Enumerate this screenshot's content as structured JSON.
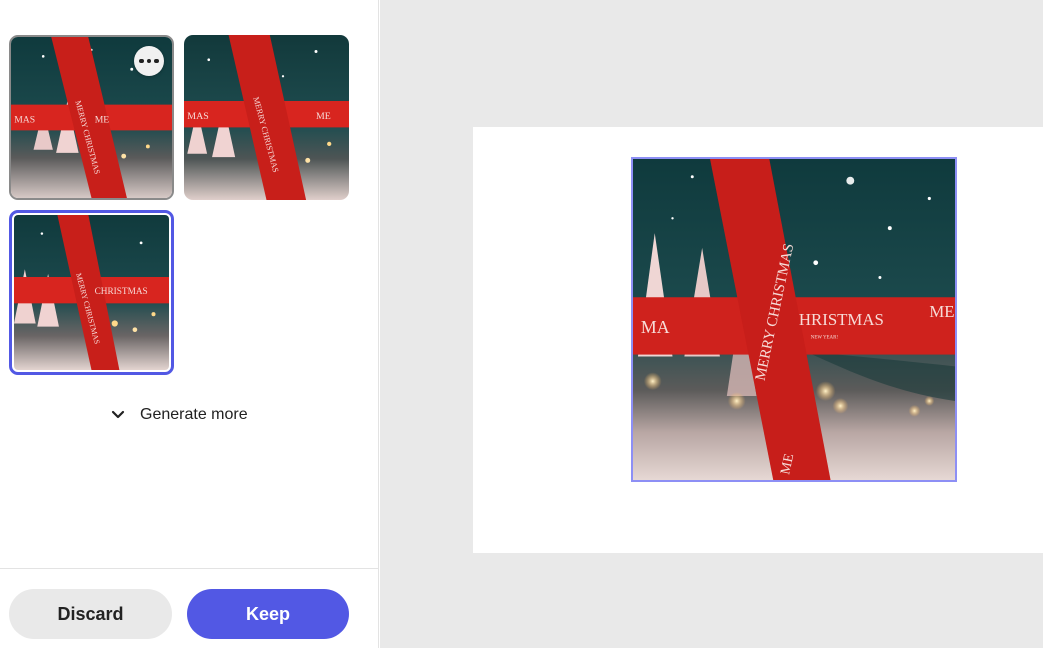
{
  "thumbnails": [
    {
      "name": "variation-1",
      "ribbon_text": "MERRY CHRISTMAS",
      "banner_text": "MAS",
      "ribbon_text_2": "ME",
      "selected": false
    },
    {
      "name": "variation-2",
      "ribbon_text": "MERRY CHRISTMAS",
      "banner_text": "MAS",
      "ribbon_text_2": "ME",
      "selected": false
    },
    {
      "name": "variation-3",
      "ribbon_text": "MERRY CHRISTMAS",
      "banner_text": "CHRISTMAS",
      "ribbon_text_2": "ME",
      "selected": true
    }
  ],
  "more_options_icon": "ellipsis-icon",
  "generate_more": {
    "label": "Generate more",
    "icon": "chevron-down-icon"
  },
  "actions": {
    "discard_label": "Discard",
    "keep_label": "Keep"
  },
  "preview": {
    "vertical_text": "MERRY CHRISTMAS",
    "horizontal_text": "HRISTMAS",
    "left_text": "MA",
    "right_text": "ME",
    "small_text": "NEW YEAR!"
  },
  "colors": {
    "accent": "#5258e4",
    "selection_outline": "#8d8ff5",
    "ribbon_red": "#d8251f",
    "sky_teal": "#1d4b4e"
  }
}
